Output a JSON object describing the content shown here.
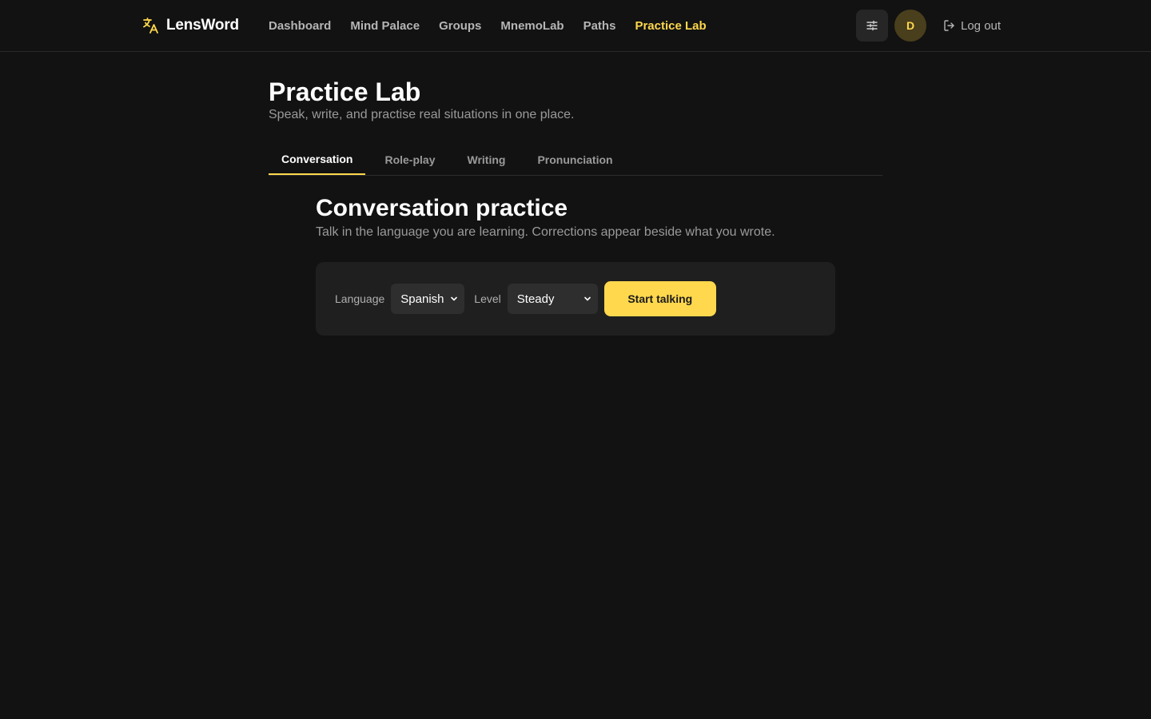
{
  "app": {
    "brand_name": "LensWord",
    "brand_icon": "translate-icon",
    "accent_color": "#ffd84d"
  },
  "nav": {
    "items": [
      {
        "label": "Dashboard",
        "active": false
      },
      {
        "label": "Mind Palace",
        "active": false
      },
      {
        "label": "Groups",
        "active": false
      },
      {
        "label": "MnemoLab",
        "active": false
      },
      {
        "label": "Paths",
        "active": false
      },
      {
        "label": "Practice Lab",
        "active": true
      }
    ],
    "settings_icon": "sliders-icon",
    "avatar_initial": "D",
    "logout_label": "Log out",
    "logout_icon": "logout-icon"
  },
  "page": {
    "title": "Practice Lab",
    "subtitle": "Speak, write, and practise real situations in one place."
  },
  "tabs": [
    {
      "label": "Conversation",
      "active": true
    },
    {
      "label": "Role-play",
      "active": false
    },
    {
      "label": "Writing",
      "active": false
    },
    {
      "label": "Pronunciation",
      "active": false
    }
  ],
  "conversation": {
    "title": "Conversation practice",
    "subtitle": "Talk in the language you are learning. Corrections appear beside what you wrote.",
    "language_label": "Language",
    "language_value": "Spanish",
    "level_label": "Level",
    "level_value": "Steady",
    "start_label": "Start talking"
  }
}
